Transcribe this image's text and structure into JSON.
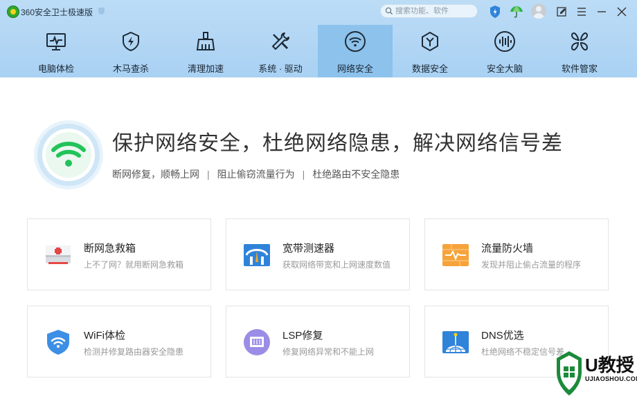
{
  "app": {
    "title": "360安全卫士极速版"
  },
  "search": {
    "placeholder": "搜索功能、软件"
  },
  "titlebar_icons": [
    "shield-bolt-icon",
    "umbrella-icon",
    "avatar",
    "feedback-icon",
    "menu-icon",
    "minimize-icon",
    "close-icon"
  ],
  "nav": {
    "active_index": 5,
    "items": [
      {
        "label": "电脑体检",
        "icon": "monitor-pulse-icon"
      },
      {
        "label": "木马查杀",
        "icon": "shield-bolt-icon"
      },
      {
        "label": "清理加速",
        "icon": "broom-icon"
      },
      {
        "label": "系统 · 驱动",
        "icon": "wrench-screwdriver-icon"
      },
      {
        "label": "网络安全",
        "icon": "wifi-icon"
      },
      {
        "label": "数据安全",
        "icon": "hexagon-y-icon"
      },
      {
        "label": "安全大脑",
        "icon": "brain-waves-icon"
      },
      {
        "label": "软件管家",
        "icon": "four-petal-icon"
      }
    ]
  },
  "hero": {
    "title": "保护网络安全，杜绝网络隐患，解决网络信号差",
    "sub": [
      "断网修复，顺畅上网",
      "阻止偷窃流量行为",
      "杜绝路由不安全隐患"
    ],
    "separator": "|"
  },
  "cards": [
    {
      "title": "断网急救箱",
      "desc": "上不了网？就用断网急救箱",
      "icon": "first-aid-kit-icon"
    },
    {
      "title": "宽带测速器",
      "desc": "获取网络带宽和上网速度数值",
      "icon": "speedometer-icon"
    },
    {
      "title": "流量防火墙",
      "desc": "发现并阻止偷占流量的程序",
      "icon": "firewall-icon"
    },
    {
      "title": "WiFi体检",
      "desc": "检测并修复路由器安全隐患",
      "icon": "wifi-shield-icon"
    },
    {
      "title": "LSP修复",
      "desc": "修复网络异常和不能上网",
      "icon": "network-port-icon"
    },
    {
      "title": "DNS优选",
      "desc": "杜绝网络不稳定信号差",
      "icon": "globe-antenna-icon"
    }
  ],
  "watermark": {
    "brand": "U教授",
    "url": "UJIAOSHOU.COM"
  },
  "colors": {
    "header_bg": "#bcdcf6",
    "nav_active_bg": "#8cc2ec",
    "wifi_green": "#22c35a",
    "accent_blue": "#2f83d9"
  }
}
